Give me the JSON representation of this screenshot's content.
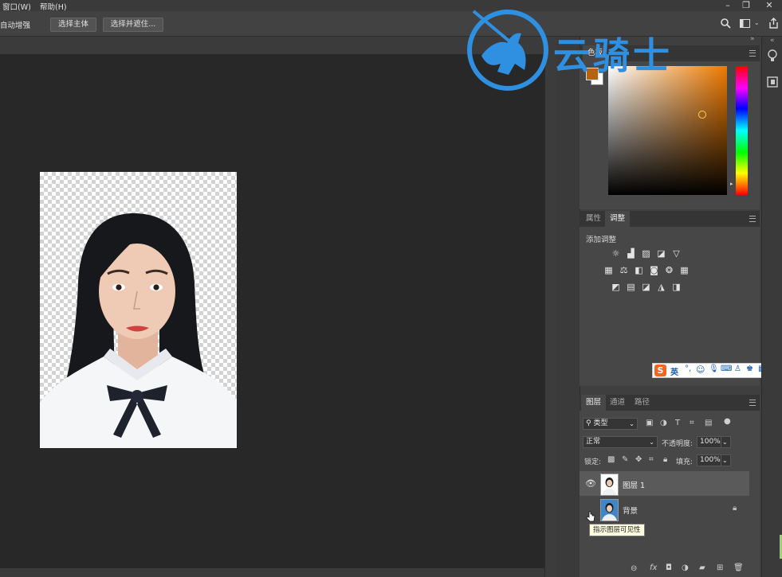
{
  "menu": {
    "window": "窗口(W)",
    "help": "帮助(H)"
  },
  "optionsbar": {
    "auto_enhance": "自动增强",
    "select_subject": "选择主体",
    "select_and_mask": "选择并遮住..."
  },
  "watermark": {
    "text": "云骑士",
    "color": "#2f8fe0"
  },
  "color_panel": {
    "foreground": "#b4630e",
    "background": "#ffffff",
    "hue_base": "#ee7a00",
    "tab_partial": "色板"
  },
  "adjust_panel": {
    "tab_properties": "属性",
    "tab_adjustments": "调整",
    "add_adjustment": "添加调整",
    "row1_icons": [
      "brightness-icon",
      "levels-icon",
      "curves-icon",
      "exposure-icon",
      "vibrance-icon"
    ],
    "row2_icons": [
      "hue-saturation-icon",
      "color-balance-icon",
      "black-white-icon",
      "photo-filter-icon",
      "channel-mixer-icon",
      "color-lookup-icon"
    ],
    "row3_icons": [
      "invert-icon",
      "posterize-icon",
      "threshold-icon",
      "selective-color-icon",
      "gradient-map-icon"
    ]
  },
  "ime_toolbar": {
    "lang": "英"
  },
  "layers_panel": {
    "tab_layers": "图层",
    "tab_channels": "通道",
    "tab_paths": "路径",
    "filter_kind": "类型",
    "blend_mode": "正常",
    "opacity_label": "不透明度:",
    "opacity_value": "100%",
    "lock_label": "锁定:",
    "fill_label": "填充:",
    "fill_value": "100%",
    "layers": [
      {
        "name": "图层 1",
        "visible": true,
        "selected": true
      },
      {
        "name": "背景",
        "visible": false,
        "locked": true
      }
    ],
    "tooltip": "指示图层可见性"
  },
  "colors": {
    "app_bg": "#282828",
    "panel": "#474747",
    "selected_layer": "#5a5a5a",
    "tooltip_bg": "#ffffe1"
  }
}
